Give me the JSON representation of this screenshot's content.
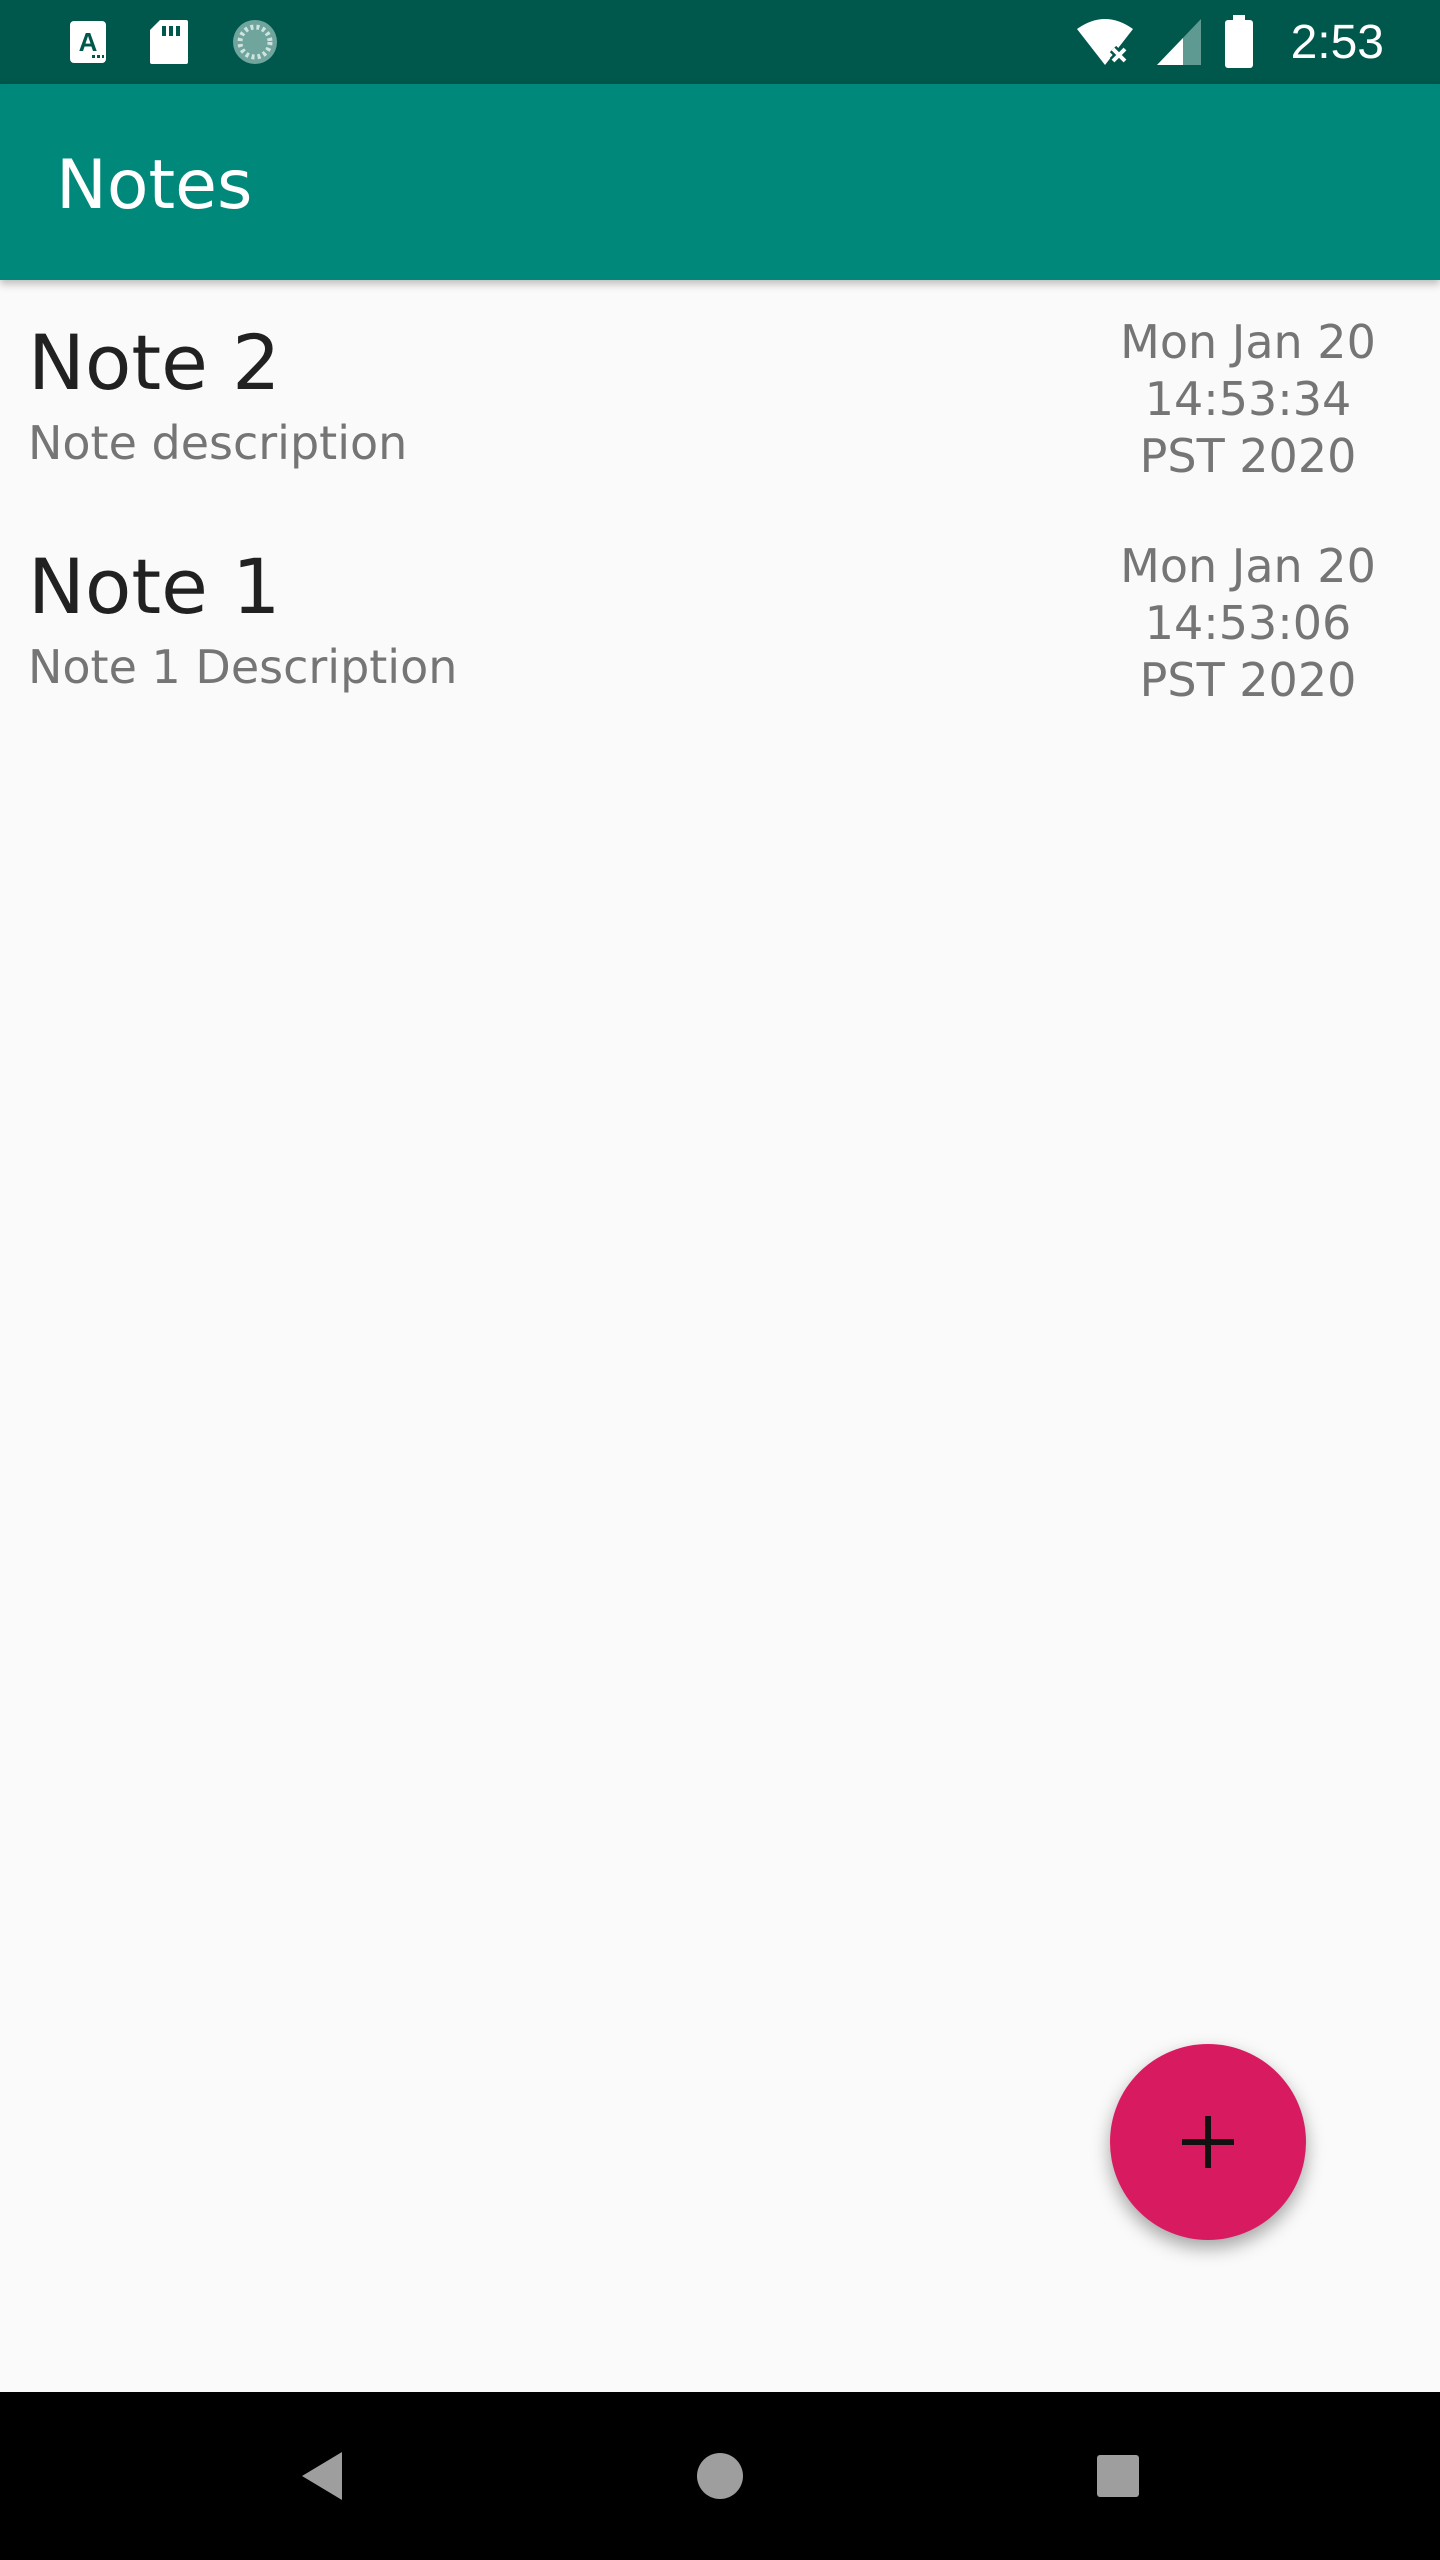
{
  "status_bar": {
    "time": "2:53",
    "left_icons": [
      "text-a-icon",
      "sd-card-icon",
      "sync-icon"
    ],
    "right_icons": [
      "wifi-off-icon",
      "signal-icon",
      "battery-icon"
    ]
  },
  "app_bar": {
    "title": "Notes"
  },
  "notes": [
    {
      "title": "Note 2",
      "description": "Note description",
      "date_line1": "Mon Jan 20",
      "date_line2": "14:53:34",
      "date_line3": "PST 2020"
    },
    {
      "title": "Note 1",
      "description": "Note 1 Description",
      "date_line1": "Mon Jan 20",
      "date_line2": "14:53:06",
      "date_line3": "PST 2020"
    }
  ],
  "fab": {
    "icon": "plus-icon",
    "color": "#d81b60"
  },
  "nav_bar": {
    "icons": [
      "back-icon",
      "home-icon",
      "recents-icon"
    ]
  },
  "colors": {
    "status_bar": "#00574b",
    "app_bar": "#00897b",
    "background": "#fafafa",
    "accent": "#d81b60"
  }
}
